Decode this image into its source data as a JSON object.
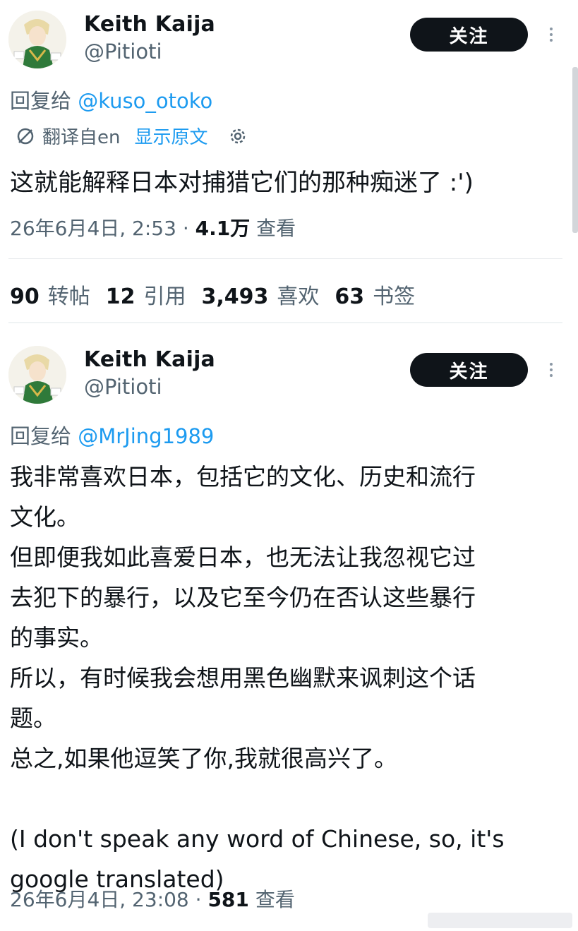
{
  "tweets": [
    {
      "author": "Keith Kaija",
      "handle": "@Pitioti",
      "follow_label": "关注",
      "reply_prefix": "回复给",
      "reply_to": "@kuso_otoko",
      "translated_from": "翻译自en",
      "show_original": "显示原文",
      "text": "这就能解释日本对捕猎它们的那种痴迷了 :')",
      "timestamp": "26年6月4日, 2:53 · ",
      "views": "4.1万",
      "views_label": "查看"
    },
    {
      "author": "Keith Kaija",
      "handle": "@Pitioti",
      "follow_label": "关注",
      "reply_prefix": "回复给",
      "reply_to": "@MrJing1989",
      "lines": [
        "我非常喜欢日本，包括它的文化、历史和流行",
        "文化。",
        "但即便我如此喜爱日本，也无法让我忽视它过",
        "去犯下的暴行，以及它至今仍在否认这些暴行",
        "的事实。",
        "所以，有时候我会想用黑色幽默来讽刺这个话",
        "题。",
        "总之,如果他逗笑了你,我就很高兴了。",
        "",
        "(I don't speak any word of Chinese, so, it's",
        "google translated)"
      ],
      "timestamp": "26年6月4日, 23:08 · ",
      "views": "581",
      "views_label": "查看"
    }
  ],
  "stats": [
    {
      "count": "90",
      "label": "转帖"
    },
    {
      "count": "12",
      "label": "引用"
    },
    {
      "count": "3,493",
      "label": "喜欢"
    },
    {
      "count": "63",
      "label": "书签"
    }
  ],
  "icons": {
    "more": "more-vertical-icon",
    "translate": "translate-icon",
    "settings": "gear-icon"
  },
  "colors": {
    "accent": "#1d9bf0",
    "text": "#0f1419",
    "muted": "#536471",
    "button": "#0f1419"
  }
}
